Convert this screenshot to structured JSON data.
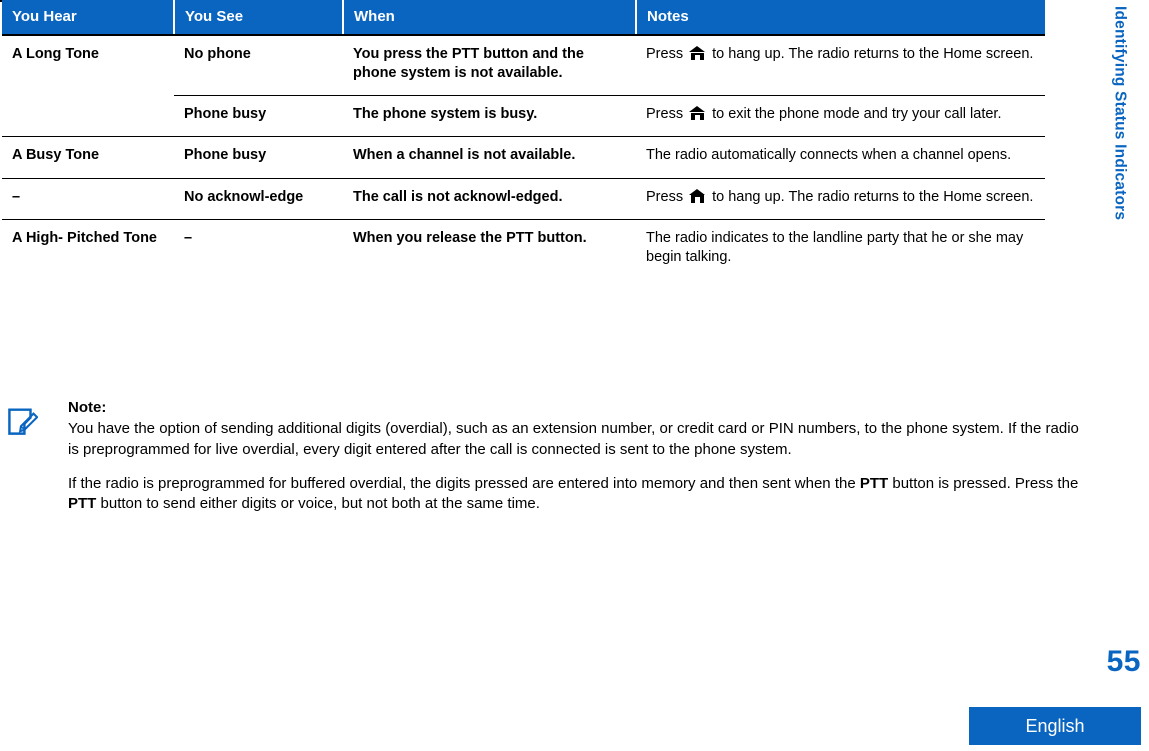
{
  "side_tab": {
    "label": "Identifying Status Indicators",
    "color": "#0A65C0"
  },
  "table": {
    "headers": [
      "You Hear",
      "You See",
      "When",
      "Notes"
    ],
    "rows": [
      {
        "you_hear": "A Long Tone",
        "you_see": "No phone",
        "when": "You press the PTT button and the phone system is not available.",
        "notes_before": "Press ",
        "notes_icon": "home-icon",
        "notes_after": " to hang up. The radio returns to the Home screen."
      },
      {
        "you_hear": "",
        "you_see": "Phone busy",
        "when": "The phone system is busy.",
        "notes_before": "Press ",
        "notes_icon": "home-icon",
        "notes_after": " to exit the phone mode and try your call later."
      },
      {
        "you_hear": "A Busy Tone",
        "you_see": "Phone busy",
        "when": "When a channel is not available.",
        "notes_before": "The radio automatically connects when a channel opens.",
        "notes_icon": "",
        "notes_after": ""
      },
      {
        "you_hear": "–",
        "you_see": "No acknowl-edge",
        "when": "The call is not acknowl-edged.",
        "notes_before": "Press ",
        "notes_icon": "home-icon",
        "notes_after": " to hang up. The radio returns to the Home screen."
      },
      {
        "you_hear": "A High- Pitched Tone",
        "you_see": "–",
        "when": "When you release the PTT button.",
        "notes_before": "The radio indicates to the landline party that he or she may begin talking.",
        "notes_icon": "",
        "notes_after": ""
      }
    ]
  },
  "note": {
    "icon": "note-pencil-icon",
    "title": "Note:",
    "paragraph1": "You have the option of sending additional digits (overdial), such as an extension number, or credit card or PIN numbers, to the phone system. If the radio is preprogrammed for live overdial, every digit entered after the call is connected is sent to the phone system.",
    "paragraph2_part1": "If the radio is preprogrammed for buffered overdial, the digits pressed are entered into memory and then sent when the ",
    "paragraph2_bold1": "PTT",
    "paragraph2_part2": " button is pressed. Press the ",
    "paragraph2_bold2": "PTT",
    "paragraph2_part3": " button to send either digits or voice, but not both at the same time."
  },
  "footer": {
    "page_number": "55",
    "language": "English",
    "accent_color": "#0A65C0"
  }
}
